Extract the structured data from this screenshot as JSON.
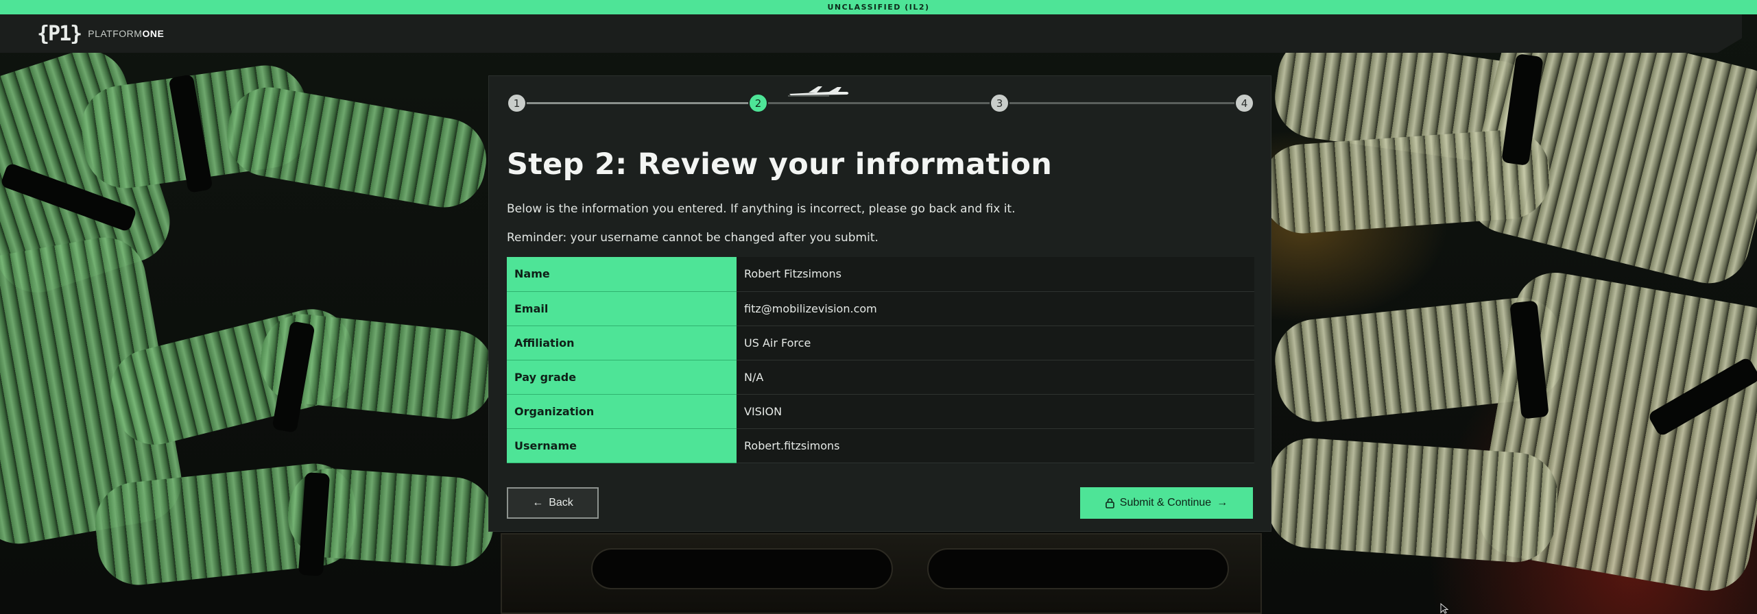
{
  "banner": {
    "text": "UNCLASSIFIED (IL2)"
  },
  "brand": {
    "mark": "{P1}",
    "name_light": "PLATFORM",
    "name_bold": "ONE"
  },
  "stepper": {
    "steps": [
      "1",
      "2",
      "3",
      "4"
    ],
    "current": 2
  },
  "page": {
    "title": "Step 2: Review your information",
    "intro": "Below is the information you entered. If anything is incorrect, please go back and fix it.",
    "reminder": "Reminder: your username cannot be changed after you submit."
  },
  "info_table": [
    {
      "label": "Name",
      "value": "Robert Fitzsimons"
    },
    {
      "label": "Email",
      "value": "fitz@mobilizevision.com"
    },
    {
      "label": "Affiliation",
      "value": "US Air Force"
    },
    {
      "label": "Pay grade",
      "value": "N/A"
    },
    {
      "label": "Organization",
      "value": "VISION"
    },
    {
      "label": "Username",
      "value": "Robert.fitzsimons"
    }
  ],
  "actions": {
    "back_label": "Back",
    "submit_label": "Submit & Continue"
  },
  "icons": {
    "back": "arrow-left-icon",
    "submit_lock": "lock-icon",
    "submit_arrow": "arrow-right-icon",
    "plane": "airplane-icon"
  },
  "colors": {
    "accent": "#4ee497",
    "card_bg": "#1c201e",
    "topbar_bg": "#1b1e1c"
  }
}
